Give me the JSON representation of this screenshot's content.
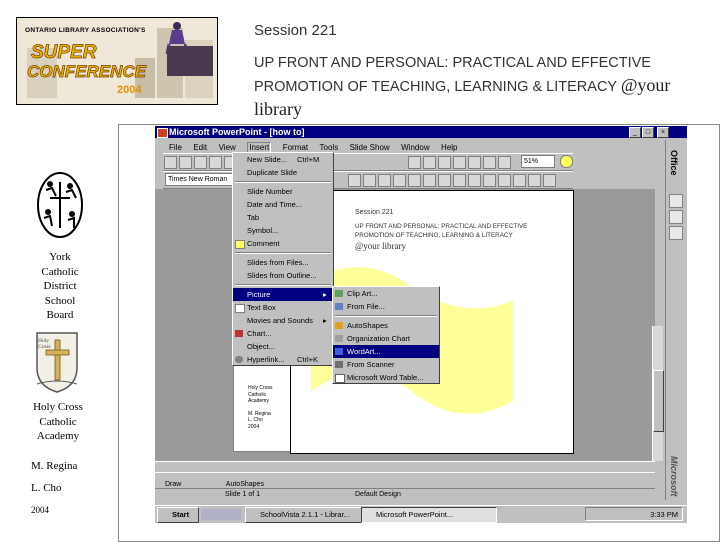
{
  "header": {
    "session": "Session 221",
    "headline_line1": "UP FRONT AND PERSONAL: PRACTICAL AND EFFECTIVE",
    "headline_line2_prefix": "PROMOTION OF TEACHING, LEARNING & LITERACY ",
    "headline_line2_suffix": "@your",
    "headline_line3": "library"
  },
  "logo": {
    "association": "ONTARIO LIBRARY ASSOCIATION'S",
    "super": "SUPER",
    "conference": "CONFERENCE",
    "year": "2004"
  },
  "left": {
    "board_lines": [
      "York",
      "Catholic",
      "District",
      "School",
      "Board"
    ],
    "school_lines": [
      "Holy Cross",
      "Catholic",
      "Academy"
    ],
    "crest_text": "Holy Cross",
    "author1": "M. Regina",
    "author2": "L. Cho",
    "year": "2004"
  },
  "ppt": {
    "title": "Microsoft PowerPoint - [how to]",
    "menus": [
      "File",
      "Edit",
      "View",
      "Insert",
      "Format",
      "Tools",
      "Slide Show",
      "Window",
      "Help"
    ],
    "font_name": "Times New Roman",
    "zoom": "51%",
    "office_label": "Office",
    "microsoft_label": "Microsoft",
    "insert_menu": [
      "New Slide...",
      "Duplicate Slide",
      "Slide Number",
      "Date and Time...",
      "Tab",
      "Symbol...",
      "Comment",
      "Slides from Files...",
      "Slides from Outline...",
      "Picture",
      "Text Box",
      "Movies and Sounds",
      "Chart...",
      "Object...",
      "Hyperlink..."
    ],
    "new_slide_shortcut": "Ctrl+M",
    "hyperlink_shortcut": "Ctrl+K",
    "picture_submenu": [
      "Clip Art...",
      "From File...",
      "AutoShapes",
      "Organization Chart",
      "WordArt...",
      "From Scanner",
      "Microsoft Word Table..."
    ],
    "slide": {
      "session": "Session 221",
      "line1": "UP FRONT AND PERSONAL: PRACTICAL AND EFFECTIVE",
      "line2": "PROMOTION OF TEACHING, LEARNING & LITERACY",
      "line3": "@your library"
    },
    "outline_text": [
      "Holy Cross",
      "Catholic",
      "Academy",
      "M. Regina",
      "L. Cho",
      "2004"
    ],
    "status_slide": "Slide 1 of 1",
    "status_design": "Default Design",
    "draw_label": "Draw",
    "autoshapes_label": "AutoShapes",
    "taskbar": {
      "start": "Start",
      "task1": "SchoolVista 2.1.1 - Librar...",
      "task2": "Microsoft PowerPoint...",
      "clock": "3:33 PM"
    }
  },
  "colors": {
    "titlebar": "#000080",
    "selection": "#000080",
    "wave": "#ffff99",
    "frame": "#c0c0c0"
  }
}
